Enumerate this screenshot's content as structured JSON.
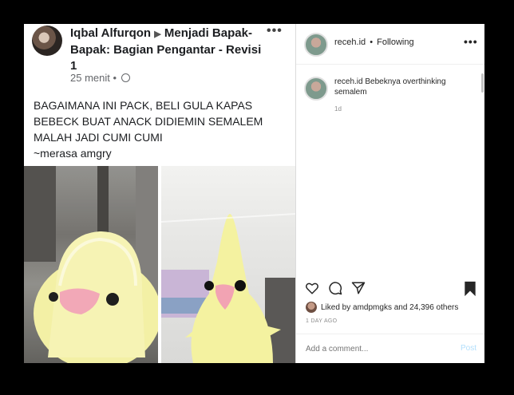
{
  "facebook": {
    "author": "Iqbal Alfurqon",
    "arrow": "▶",
    "group": "Menjadi Bapak-Bapak: Bagian Pengantar - Revisi 1",
    "time": "25 menit",
    "dot": "•",
    "more": "•••",
    "post_lines": [
      "BAGAIMANA INI PACK, BELI GULA KAPAS",
      "BEBECK BUAT ANACK DIDIEMIN SEMALEM",
      "MALAH JADI CUMI CUMI",
      "~merasa amgry"
    ]
  },
  "instagram": {
    "username": "receh.id",
    "follow_separator": "•",
    "follow_status": "Following",
    "more": "•••",
    "caption_user": "receh.id",
    "caption_text": "Bebeknya overthinking semalem",
    "caption_age": "1d",
    "icons": [
      "heart-icon",
      "comment-icon",
      "share-icon",
      "bookmark-icon"
    ],
    "likes_prefix": "Liked by",
    "likes_user": "amdpmgks",
    "likes_suffix": "and 24,396 others",
    "date": "1 DAY AGO",
    "comment_placeholder": "Add a comment...",
    "post_label": "Post"
  },
  "colors": {
    "accent_blue": "#b2dffc",
    "text_dark": "#262626",
    "muted": "#8e8e8e"
  }
}
